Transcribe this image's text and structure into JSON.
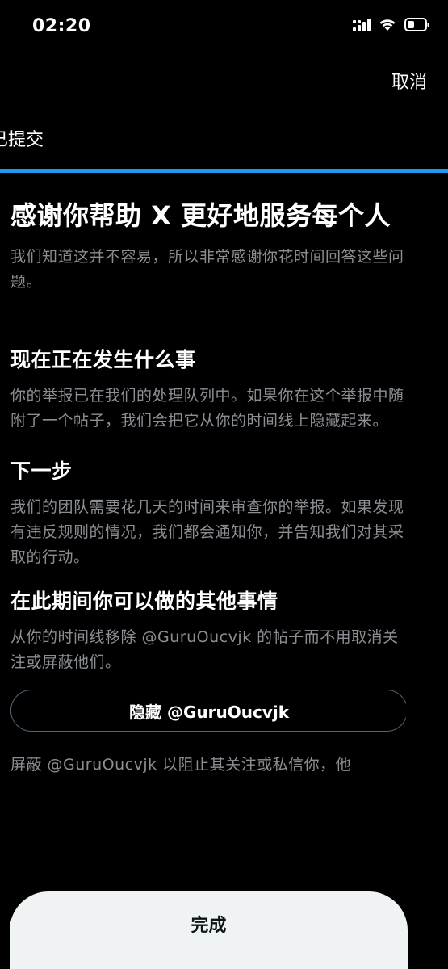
{
  "status_bar": {
    "time": "02:20"
  },
  "header": {
    "cancel_label": "取消",
    "step_label": "已提交",
    "accent_color": "#1d9bf0"
  },
  "main": {
    "title": "感谢你帮助 X 更好地服务每个人",
    "subtitle": "我们知道这并不容易，所以非常感谢你花时间回答这些问题。",
    "sections": [
      {
        "heading": "现在正在发生什么事",
        "body": "你的举报已在我们的处理队列中。如果你在这个举报中随附了一个帖子，我们会把它从你的时间线上隐藏起来。"
      },
      {
        "heading": "下一步",
        "body": "我们的团队需要花几天的时间来审查你的举报。如果发现有违反规则的情况，我们都会通知你，并告知我们对其采取的行动。"
      },
      {
        "heading": "在此期间你可以做的其他事情",
        "body": "从你的时间线移除 @GuruOucvjk 的帖子而不用取消关注或屏蔽他们。"
      }
    ],
    "hide_button_label": "隐藏 @GuruOucvjk",
    "block_text_partial": "屏蔽 @GuruOucvjk 以阻止其关注或私信你，他"
  },
  "footer": {
    "done_label": "完成"
  }
}
